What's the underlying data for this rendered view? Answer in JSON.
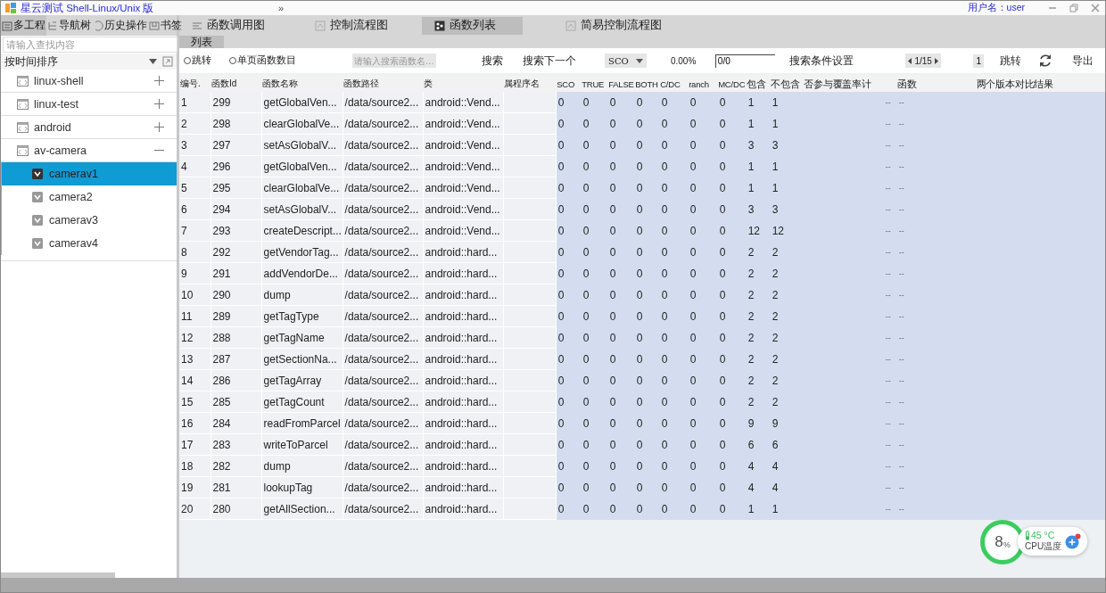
{
  "window": {
    "title": "星云测试 Shell-Linux/Unix 版",
    "overflow": "»",
    "user": "用户名：user"
  },
  "side_tabs": [
    {
      "label": "多工程",
      "selected": true
    },
    {
      "label": "导航树",
      "selected": false
    },
    {
      "label": "历史操作",
      "selected": false
    },
    {
      "label": "书签",
      "selected": false
    }
  ],
  "main_tabs": [
    {
      "label": "函数调用图",
      "selected": false
    },
    {
      "label": "控制流程图",
      "selected": false
    },
    {
      "label": "函数列表",
      "selected": true
    },
    {
      "label": "简易控制流程图",
      "selected": false
    }
  ],
  "sub_tab": "列表",
  "sidebar": {
    "search_placeholder": "请输入查找内容",
    "sort_label": "按时间排序",
    "items": [
      {
        "label": "linux-shell",
        "expanded": false
      },
      {
        "label": "linux-test",
        "expanded": false
      },
      {
        "label": "android",
        "expanded": false
      },
      {
        "label": "av-camera",
        "expanded": true,
        "children": [
          {
            "label": "camerav1",
            "selected": true
          },
          {
            "label": "camera2",
            "selected": false
          },
          {
            "label": "camerav3",
            "selected": false
          },
          {
            "label": "camerav4",
            "selected": false
          }
        ]
      }
    ]
  },
  "toolbar": [
    {
      "kind": "radio",
      "label": "跳转",
      "selected": false
    },
    {
      "kind": "radio",
      "label": "单页函数数目",
      "selected": false
    },
    {
      "kind": "search",
      "placeholder": "请输入搜索函数名…"
    },
    {
      "kind": "button",
      "label": "搜索"
    },
    {
      "kind": "button",
      "label": "搜索下一个"
    },
    {
      "kind": "dropdown",
      "value": "SCO"
    },
    {
      "kind": "text",
      "label": "0.00%"
    },
    {
      "kind": "input",
      "value": "0/0"
    },
    {
      "kind": "button",
      "label": "搜索条件设置"
    },
    {
      "kind": "pager",
      "value": "1/15"
    },
    {
      "kind": "page",
      "value": "1"
    },
    {
      "kind": "button",
      "label": "跳转"
    },
    {
      "kind": "refresh"
    },
    {
      "kind": "button",
      "label": "导出"
    }
  ],
  "table": {
    "columns": [
      "编号.",
      "函数Id",
      "函数名称",
      "函数路径",
      "类",
      "属程序名",
      "SCO",
      "TRUE",
      "FALSE",
      "BOTH",
      "C/DC",
      "ranch",
      "MC/DC",
      "包含",
      "不包含",
      "否参与覆盖率计",
      "函数",
      "两个版本对比结果"
    ],
    "rows": [
      [
        "1",
        "299",
        "getGlobalVen...",
        "/data/source2...",
        "android::Vend...",
        "",
        "0",
        "0",
        "0",
        "0",
        "0",
        "0",
        "0",
        "1",
        "1",
        "--",
        "--",
        ""
      ],
      [
        "2",
        "298",
        "clearGlobalVe...",
        "/data/source2...",
        "android::Vend...",
        "",
        "0",
        "0",
        "0",
        "0",
        "0",
        "0",
        "0",
        "1",
        "1",
        "--",
        "--",
        ""
      ],
      [
        "3",
        "297",
        "setAsGlobalV...",
        "/data/source2...",
        "android::Vend...",
        "",
        "0",
        "0",
        "0",
        "0",
        "0",
        "0",
        "0",
        "3",
        "3",
        "--",
        "--",
        ""
      ],
      [
        "4",
        "296",
        "getGlobalVen...",
        "/data/source2...",
        "android::Vend...",
        "",
        "0",
        "0",
        "0",
        "0",
        "0",
        "0",
        "0",
        "1",
        "1",
        "--",
        "--",
        ""
      ],
      [
        "5",
        "295",
        "clearGlobalVe...",
        "/data/source2...",
        "android::Vend...",
        "",
        "0",
        "0",
        "0",
        "0",
        "0",
        "0",
        "0",
        "1",
        "1",
        "--",
        "--",
        ""
      ],
      [
        "6",
        "294",
        "setAsGlobalV...",
        "/data/source2...",
        "android::Vend...",
        "",
        "0",
        "0",
        "0",
        "0",
        "0",
        "0",
        "0",
        "3",
        "3",
        "--",
        "--",
        ""
      ],
      [
        "7",
        "293",
        "createDescript...",
        "/data/source2...",
        "android::Vend...",
        "",
        "0",
        "0",
        "0",
        "0",
        "0",
        "0",
        "0",
        "12",
        "12",
        "--",
        "--",
        ""
      ],
      [
        "8",
        "292",
        "getVendorTag...",
        "/data/source2...",
        "android::hard...",
        "",
        "0",
        "0",
        "0",
        "0",
        "0",
        "0",
        "0",
        "2",
        "2",
        "--",
        "--",
        ""
      ],
      [
        "9",
        "291",
        "addVendorDe...",
        "/data/source2...",
        "android::hard...",
        "",
        "0",
        "0",
        "0",
        "0",
        "0",
        "0",
        "0",
        "2",
        "2",
        "--",
        "--",
        ""
      ],
      [
        "10",
        "290",
        "dump",
        "/data/source2...",
        "android::hard...",
        "",
        "0",
        "0",
        "0",
        "0",
        "0",
        "0",
        "0",
        "2",
        "2",
        "--",
        "--",
        ""
      ],
      [
        "11",
        "289",
        "getTagType",
        "/data/source2...",
        "android::hard...",
        "",
        "0",
        "0",
        "0",
        "0",
        "0",
        "0",
        "0",
        "2",
        "2",
        "--",
        "--",
        ""
      ],
      [
        "12",
        "288",
        "getTagName",
        "/data/source2...",
        "android::hard...",
        "",
        "0",
        "0",
        "0",
        "0",
        "0",
        "0",
        "0",
        "2",
        "2",
        "--",
        "--",
        ""
      ],
      [
        "13",
        "287",
        "getSectionNa...",
        "/data/source2...",
        "android::hard...",
        "",
        "0",
        "0",
        "0",
        "0",
        "0",
        "0",
        "0",
        "2",
        "2",
        "--",
        "--",
        ""
      ],
      [
        "14",
        "286",
        "getTagArray",
        "/data/source2...",
        "android::hard...",
        "",
        "0",
        "0",
        "0",
        "0",
        "0",
        "0",
        "0",
        "2",
        "2",
        "--",
        "--",
        ""
      ],
      [
        "15",
        "285",
        "getTagCount",
        "/data/source2...",
        "android::hard...",
        "",
        "0",
        "0",
        "0",
        "0",
        "0",
        "0",
        "0",
        "2",
        "2",
        "--",
        "--",
        ""
      ],
      [
        "16",
        "284",
        "readFromParcel",
        "/data/source2...",
        "android::hard...",
        "",
        "0",
        "0",
        "0",
        "0",
        "0",
        "0",
        "0",
        "9",
        "9",
        "--",
        "--",
        ""
      ],
      [
        "17",
        "283",
        "writeToParcel",
        "/data/source2...",
        "android::hard...",
        "",
        "0",
        "0",
        "0",
        "0",
        "0",
        "0",
        "0",
        "6",
        "6",
        "--",
        "--",
        ""
      ],
      [
        "18",
        "282",
        "dump",
        "/data/source2...",
        "android::hard...",
        "",
        "0",
        "0",
        "0",
        "0",
        "0",
        "0",
        "0",
        "4",
        "4",
        "--",
        "--",
        ""
      ],
      [
        "19",
        "281",
        "lookupTag",
        "/data/source2...",
        "android::hard...",
        "",
        "0",
        "0",
        "0",
        "0",
        "0",
        "0",
        "0",
        "4",
        "4",
        "--",
        "--",
        ""
      ],
      [
        "20",
        "280",
        "getAllSection...",
        "/data/source2...",
        "android::hard...",
        "",
        "0",
        "0",
        "0",
        "0",
        "0",
        "0",
        "0",
        "1",
        "1",
        "--",
        "--",
        ""
      ]
    ]
  },
  "cpu_widget": {
    "usage": "8",
    "unit": "%",
    "temperature": "45 °C",
    "label": "CPU温度"
  }
}
